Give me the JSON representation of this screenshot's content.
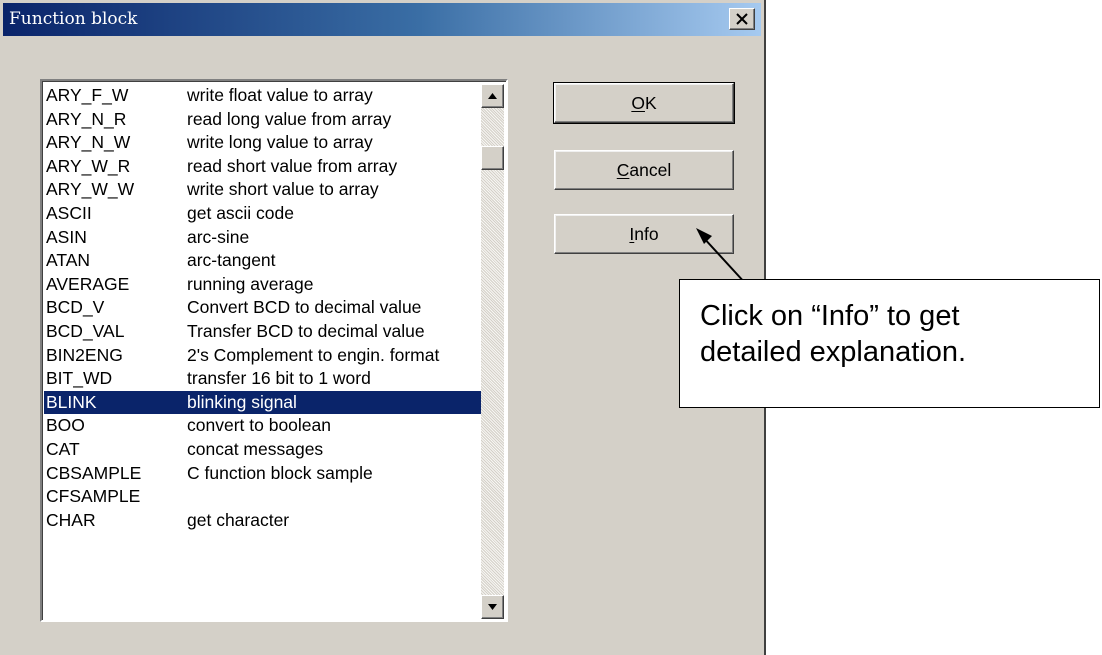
{
  "window": {
    "title": "Function block",
    "close_glyph": "✕"
  },
  "list": {
    "rows": [
      {
        "name": "ARY_F_W",
        "desc": "write float value to array"
      },
      {
        "name": "ARY_N_R",
        "desc": "read long value from array"
      },
      {
        "name": "ARY_N_W",
        "desc": "write long value to array"
      },
      {
        "name": "ARY_W_R",
        "desc": "read short value from array"
      },
      {
        "name": "ARY_W_W",
        "desc": "write short value to array"
      },
      {
        "name": "ASCII",
        "desc": "get ascii code"
      },
      {
        "name": "ASIN",
        "desc": "arc-sine"
      },
      {
        "name": "ATAN",
        "desc": "arc-tangent"
      },
      {
        "name": "AVERAGE",
        "desc": "running average"
      },
      {
        "name": "BCD_V",
        "desc": "Convert BCD to decimal value"
      },
      {
        "name": "BCD_VAL",
        "desc": "Transfer BCD to decimal value"
      },
      {
        "name": "BIN2ENG",
        "desc": "2's Complement to engin. format"
      },
      {
        "name": "BIT_WD",
        "desc": "transfer 16 bit to 1 word"
      },
      {
        "name": "BLINK",
        "desc": "blinking signal"
      },
      {
        "name": "BOO",
        "desc": "convert to boolean"
      },
      {
        "name": "CAT",
        "desc": "concat messages"
      },
      {
        "name": "CBSAMPLE",
        "desc": "C function block sample"
      },
      {
        "name": "CFSAMPLE",
        "desc": ""
      },
      {
        "name": "CHAR",
        "desc": "get character"
      }
    ],
    "selected_index": 13
  },
  "buttons": {
    "ok": {
      "mnemonic": "O",
      "rest": "K"
    },
    "cancel": {
      "mnemonic": "C",
      "rest": "ancel"
    },
    "info": {
      "mnemonic": "I",
      "rest": "nfo"
    }
  },
  "callout": {
    "line1": "Click on “Info” to get",
    "line2": "detailed explanation."
  },
  "colors": {
    "selection": "#0a246a",
    "dialog_face": "#d4d0c8"
  }
}
